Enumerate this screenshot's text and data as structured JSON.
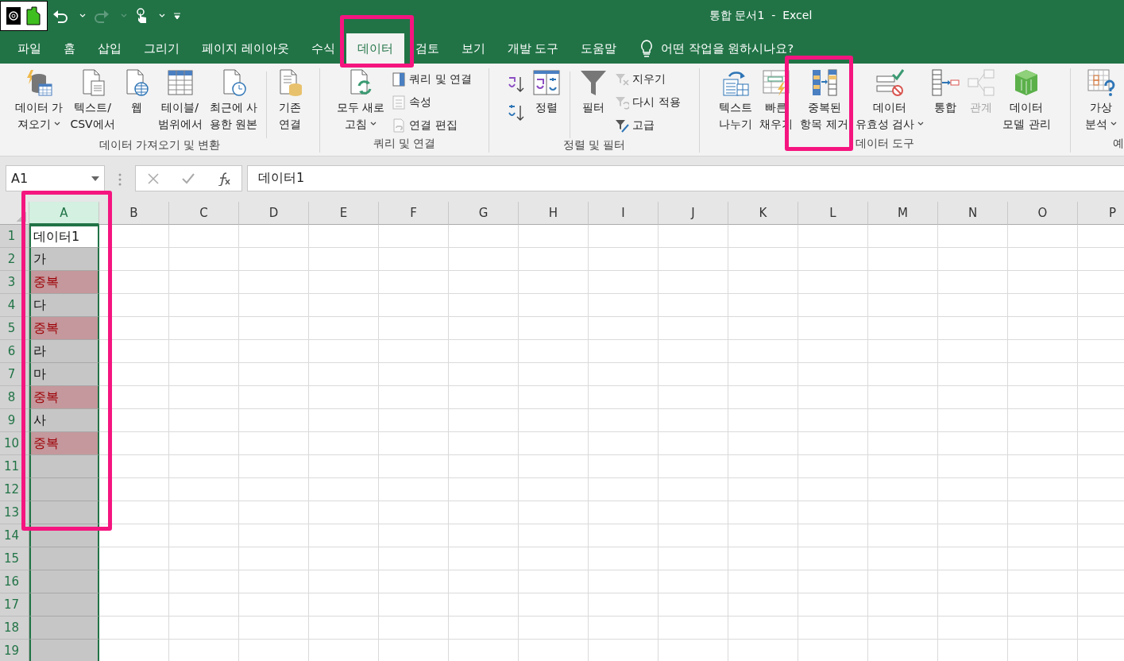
{
  "window": {
    "title": "통합 문서1  -  Excel"
  },
  "tabs": [
    {
      "label": "파일",
      "selected": false
    },
    {
      "label": "홈",
      "selected": false
    },
    {
      "label": "삽입",
      "selected": false
    },
    {
      "label": "그리기",
      "selected": false
    },
    {
      "label": "페이지 레이아웃",
      "selected": false
    },
    {
      "label": "수식",
      "selected": false
    },
    {
      "label": "데이터",
      "selected": true
    },
    {
      "label": "검토",
      "selected": false
    },
    {
      "label": "보기",
      "selected": false
    },
    {
      "label": "개발 도구",
      "selected": false
    },
    {
      "label": "도움말",
      "selected": false
    }
  ],
  "tell_me": {
    "text": "어떤 작업을 원하시나요?"
  },
  "ribbon": {
    "groups": [
      {
        "label": "데이터 가져오기 및 변환",
        "items": [
          {
            "kind": "large",
            "lines": [
              "데이터 가",
              "져오기"
            ],
            "dropdown": true,
            "disabled": false
          },
          {
            "kind": "large",
            "lines": [
              "텍스트/",
              "CSV에서"
            ],
            "dropdown": false,
            "disabled": false
          },
          {
            "kind": "large",
            "lines": [
              "웹"
            ],
            "dropdown": false,
            "disabled": false
          },
          {
            "kind": "large",
            "lines": [
              "테이블/",
              "범위에서"
            ],
            "dropdown": false,
            "disabled": false
          },
          {
            "kind": "large",
            "lines": [
              "최근에 사",
              "용한 원본"
            ],
            "dropdown": false,
            "disabled": false
          },
          {
            "kind": "separator"
          },
          {
            "kind": "large",
            "lines": [
              "기존",
              "연결"
            ],
            "dropdown": false,
            "disabled": false
          }
        ]
      },
      {
        "label": "쿼리 및 연결",
        "items": [
          {
            "kind": "large",
            "lines": [
              "모두 새로",
              "고침"
            ],
            "dropdown": true,
            "disabled": false
          },
          {
            "kind": "stack",
            "items": [
              {
                "label": "쿼리 및 연결",
                "disabled": false
              },
              {
                "label": "속성",
                "disabled": true
              },
              {
                "label": "연결 편집",
                "disabled": true
              }
            ]
          }
        ]
      },
      {
        "label": "정렬 및 필터",
        "items": [
          {
            "kind": "sort_pair"
          },
          {
            "kind": "large",
            "lines": [
              "정렬"
            ],
            "dropdown": false,
            "disabled": false
          },
          {
            "kind": "separator"
          },
          {
            "kind": "large",
            "lines": [
              "필터"
            ],
            "dropdown": false,
            "disabled": false
          },
          {
            "kind": "stack",
            "items": [
              {
                "label": "지우기",
                "disabled": true
              },
              {
                "label": "다시 적용",
                "disabled": true
              },
              {
                "label": "고급",
                "disabled": false
              }
            ]
          }
        ]
      },
      {
        "label": "데이터 도구",
        "items": [
          {
            "kind": "large",
            "lines": [
              "텍스트",
              "나누기"
            ],
            "dropdown": false,
            "disabled": false
          },
          {
            "kind": "large",
            "lines": [
              "빠른",
              "채우기"
            ],
            "dropdown": false,
            "disabled": false
          },
          {
            "kind": "large",
            "lines": [
              "중복된",
              "항목 제거"
            ],
            "dropdown": false,
            "disabled": false
          },
          {
            "kind": "large",
            "lines": [
              "데이터",
              "유효성 검사"
            ],
            "dropdown": true,
            "disabled": false
          },
          {
            "kind": "large",
            "lines": [
              "통합"
            ],
            "dropdown": false,
            "disabled": false
          },
          {
            "kind": "large",
            "lines": [
              "관계"
            ],
            "dropdown": false,
            "disabled": true
          },
          {
            "kind": "large",
            "lines": [
              "데이터",
              "모델 관리"
            ],
            "dropdown": false,
            "disabled": false
          }
        ]
      },
      {
        "label": "예",
        "items": [
          {
            "kind": "large",
            "lines": [
              "가상",
              "분석"
            ],
            "dropdown": true,
            "disabled": false
          }
        ]
      }
    ]
  },
  "formula_bar": {
    "name_box": "A1",
    "formula": "데이터1"
  },
  "sheet": {
    "columns": [
      {
        "label": "A",
        "selected": true
      },
      {
        "label": "B",
        "selected": false
      },
      {
        "label": "C",
        "selected": false
      },
      {
        "label": "D",
        "selected": false
      },
      {
        "label": "E",
        "selected": false
      },
      {
        "label": "F",
        "selected": false
      },
      {
        "label": "G",
        "selected": false
      },
      {
        "label": "H",
        "selected": false
      },
      {
        "label": "I",
        "selected": false
      },
      {
        "label": "J",
        "selected": false
      },
      {
        "label": "K",
        "selected": false
      },
      {
        "label": "L",
        "selected": false
      },
      {
        "label": "M",
        "selected": false
      },
      {
        "label": "N",
        "selected": false
      },
      {
        "label": "O",
        "selected": false
      },
      {
        "label": "P",
        "selected": false
      }
    ],
    "rows": [
      "1",
      "2",
      "3",
      "4",
      "5",
      "6",
      "7",
      "8",
      "9",
      "10",
      "11",
      "12",
      "13",
      "14",
      "15",
      "16",
      "17",
      "18",
      "19"
    ],
    "cells": [
      {
        "text": "데이터1",
        "active": true,
        "duplicate": false
      },
      {
        "text": "가",
        "active": false,
        "duplicate": false
      },
      {
        "text": "중복",
        "active": false,
        "duplicate": true
      },
      {
        "text": "다",
        "active": false,
        "duplicate": false
      },
      {
        "text": "중복",
        "active": false,
        "duplicate": true
      },
      {
        "text": "라",
        "active": false,
        "duplicate": false
      },
      {
        "text": "마",
        "active": false,
        "duplicate": false
      },
      {
        "text": "중복",
        "active": false,
        "duplicate": true
      },
      {
        "text": "사",
        "active": false,
        "duplicate": false
      },
      {
        "text": "중복",
        "active": false,
        "duplicate": true
      }
    ]
  }
}
